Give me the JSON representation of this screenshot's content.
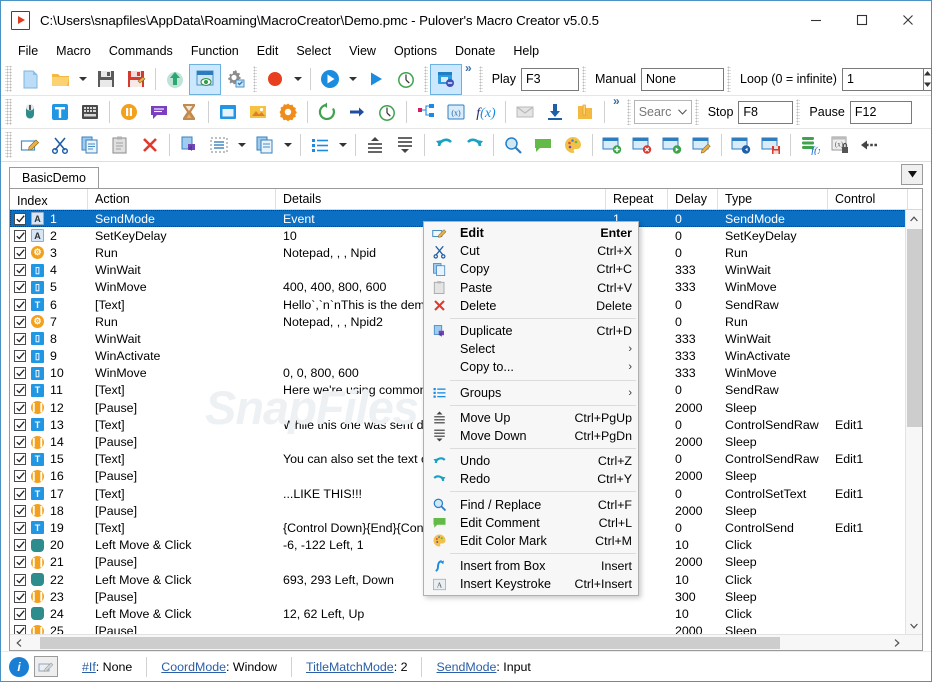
{
  "window": {
    "title": "C:\\Users\\snapfiles\\AppData\\Roaming\\MacroCreator\\Demo.pmc - Pulover's Macro Creator v5.0.5",
    "app_icon": "play-document-icon",
    "minimize": "Minimize",
    "maximize": "Maximize",
    "close": "Close"
  },
  "menubar": {
    "items": [
      {
        "label": "File"
      },
      {
        "label": "Macro"
      },
      {
        "label": "Commands"
      },
      {
        "label": "Function"
      },
      {
        "label": "Edit"
      },
      {
        "label": "Select"
      },
      {
        "label": "View"
      },
      {
        "label": "Options"
      },
      {
        "label": "Donate"
      },
      {
        "label": "Help"
      }
    ]
  },
  "toolbar": {
    "row1_fields": {
      "play_label": "Play",
      "play_value": "F3",
      "manual_label": "Manual",
      "manual_value": "None",
      "loop_label": "Loop (0 = infinite)",
      "loop_value": "1"
    },
    "row2_fields": {
      "search_value": "Searc",
      "stop_label": "Stop",
      "stop_value": "F8",
      "pause_label": "Pause",
      "pause_value": "F12"
    },
    "overflow_label": "»"
  },
  "tabs": {
    "items": [
      {
        "label": "BasicDemo"
      }
    ],
    "dropdown_label": "▼"
  },
  "list": {
    "columns": [
      {
        "key": "index",
        "label": "Index"
      },
      {
        "key": "action",
        "label": "Action"
      },
      {
        "key": "details",
        "label": "Details"
      },
      {
        "key": "repeat",
        "label": "Repeat"
      },
      {
        "key": "delay",
        "label": "Delay"
      },
      {
        "key": "type",
        "label": "Type"
      },
      {
        "key": "control",
        "label": "Control"
      }
    ],
    "watermark": "SnapFiles",
    "rows": [
      {
        "checked": true,
        "icon": "keyboard-icon",
        "index": "1",
        "action": "SendMode",
        "details": "Event",
        "repeat": "1",
        "delay": "0",
        "type": "SendMode",
        "control": "",
        "selected": true
      },
      {
        "checked": true,
        "icon": "keyboard-icon",
        "index": "2",
        "action": "SetKeyDelay",
        "details": "10",
        "repeat": "",
        "delay": "0",
        "type": "SetKeyDelay",
        "control": ""
      },
      {
        "checked": true,
        "icon": "run-icon",
        "index": "3",
        "action": "Run",
        "details": "Notepad, , , Npid",
        "repeat": "",
        "delay": "0",
        "type": "Run",
        "control": ""
      },
      {
        "checked": true,
        "icon": "window-icon",
        "index": "4",
        "action": "WinWait",
        "details": "",
        "repeat": "",
        "delay": "333",
        "type": "WinWait",
        "control": ""
      },
      {
        "checked": true,
        "icon": "window-icon",
        "index": "5",
        "action": "WinMove",
        "details": "400, 400, 800, 600",
        "repeat": "",
        "delay": "333",
        "type": "WinMove",
        "control": ""
      },
      {
        "checked": true,
        "icon": "text-icon",
        "index": "6",
        "action": "[Text]",
        "details": "Hello`,`n`nThis is the demonstrati",
        "repeat": "",
        "delay": "0",
        "type": "SendRaw",
        "control": ""
      },
      {
        "checked": true,
        "icon": "run-icon",
        "index": "7",
        "action": "Run",
        "details": "Notepad, , , Npid2",
        "repeat": "",
        "delay": "0",
        "type": "Run",
        "control": ""
      },
      {
        "checked": true,
        "icon": "window-icon",
        "index": "8",
        "action": "WinWait",
        "details": "",
        "repeat": "",
        "delay": "333",
        "type": "WinWait",
        "control": ""
      },
      {
        "checked": true,
        "icon": "window-icon",
        "index": "9",
        "action": "WinActivate",
        "details": "",
        "repeat": "",
        "delay": "333",
        "type": "WinActivate",
        "control": ""
      },
      {
        "checked": true,
        "icon": "window-icon",
        "index": "10",
        "action": "WinMove",
        "details": "0, 0, 800, 600",
        "repeat": "",
        "delay": "333",
        "type": "WinMove",
        "control": ""
      },
      {
        "checked": true,
        "icon": "text-icon",
        "index": "11",
        "action": "[Text]",
        "details": "Here we're using commonly used",
        "repeat": "",
        "delay": "0",
        "type": "SendRaw",
        "control": ""
      },
      {
        "checked": true,
        "icon": "pause-icon",
        "index": "12",
        "action": "[Pause]",
        "details": "",
        "repeat": "",
        "delay": "2000",
        "type": "Sleep",
        "control": ""
      },
      {
        "checked": true,
        "icon": "text-icon",
        "index": "13",
        "action": "[Text]",
        "details": "While this one was sent directly t",
        "repeat": "",
        "delay": "0",
        "type": "ControlSendRaw",
        "control": "Edit1"
      },
      {
        "checked": true,
        "icon": "pause-icon",
        "index": "14",
        "action": "[Pause]",
        "details": "",
        "repeat": "",
        "delay": "2000",
        "type": "Sleep",
        "control": ""
      },
      {
        "checked": true,
        "icon": "text-icon",
        "index": "15",
        "action": "[Text]",
        "details": "You can also set the text of the e",
        "repeat": "",
        "delay": "0",
        "type": "ControlSendRaw",
        "control": "Edit1"
      },
      {
        "checked": true,
        "icon": "pause-icon",
        "index": "16",
        "action": "[Pause]",
        "details": "",
        "repeat": "",
        "delay": "2000",
        "type": "Sleep",
        "control": ""
      },
      {
        "checked": true,
        "icon": "text-icon",
        "index": "17",
        "action": "[Text]",
        "details": "...LIKE THIS!!!",
        "repeat": "",
        "delay": "0",
        "type": "ControlSetText",
        "control": "Edit1"
      },
      {
        "checked": true,
        "icon": "pause-icon",
        "index": "18",
        "action": "[Pause]",
        "details": "",
        "repeat": "",
        "delay": "2000",
        "type": "Sleep",
        "control": ""
      },
      {
        "checked": true,
        "icon": "text-icon",
        "index": "19",
        "action": "[Text]",
        "details": "{Control Down}{End}{Control UP",
        "repeat": "",
        "delay": "0",
        "type": "ControlSend",
        "control": "Edit1"
      },
      {
        "checked": true,
        "icon": "mouse-icon",
        "index": "20",
        "action": "Left Move & Click",
        "details": "-6, -122 Left, 1",
        "repeat": "",
        "delay": "10",
        "type": "Click",
        "control": ""
      },
      {
        "checked": true,
        "icon": "pause-icon",
        "index": "21",
        "action": "[Pause]",
        "details": "",
        "repeat": "",
        "delay": "2000",
        "type": "Sleep",
        "control": ""
      },
      {
        "checked": true,
        "icon": "mouse-icon",
        "index": "22",
        "action": "Left Move & Click",
        "details": "693, 293 Left, Down",
        "repeat": "",
        "delay": "10",
        "type": "Click",
        "control": ""
      },
      {
        "checked": true,
        "icon": "pause-icon",
        "index": "23",
        "action": "[Pause]",
        "details": "",
        "repeat": "",
        "delay": "300",
        "type": "Sleep",
        "control": ""
      },
      {
        "checked": true,
        "icon": "mouse-icon",
        "index": "24",
        "action": "Left Move & Click",
        "details": "12, 62 Left, Up",
        "repeat": "",
        "delay": "10",
        "type": "Click",
        "control": ""
      },
      {
        "checked": true,
        "icon": "pause-icon",
        "index": "25",
        "action": "[Pause]",
        "details": "",
        "repeat": "",
        "delay": "2000",
        "type": "Sleep",
        "control": ""
      }
    ]
  },
  "context_menu": {
    "items": [
      {
        "icon": "edit-icon",
        "label": "Edit",
        "accel": "Enter",
        "bold": true
      },
      {
        "icon": "cut-icon",
        "label": "Cut",
        "accel": "Ctrl+X"
      },
      {
        "icon": "copy-icon",
        "label": "Copy",
        "accel": "Ctrl+C"
      },
      {
        "icon": "paste-icon",
        "label": "Paste",
        "accel": "Ctrl+V"
      },
      {
        "icon": "delete-icon",
        "label": "Delete",
        "accel": "Delete"
      },
      {
        "separator": true
      },
      {
        "icon": "duplicate-icon",
        "label": "Duplicate",
        "accel": "Ctrl+D"
      },
      {
        "icon": "",
        "label": "Select",
        "submenu": true
      },
      {
        "icon": "",
        "label": "Copy to...",
        "submenu": true
      },
      {
        "separator": true
      },
      {
        "icon": "groups-icon",
        "label": "Groups",
        "submenu": true
      },
      {
        "separator": true
      },
      {
        "icon": "move-up-icon",
        "label": "Move Up",
        "accel": "Ctrl+PgUp"
      },
      {
        "icon": "move-down-icon",
        "label": "Move Down",
        "accel": "Ctrl+PgDn"
      },
      {
        "separator": true
      },
      {
        "icon": "undo-icon",
        "label": "Undo",
        "accel": "Ctrl+Z"
      },
      {
        "icon": "redo-icon",
        "label": "Redo",
        "accel": "Ctrl+Y"
      },
      {
        "separator": true
      },
      {
        "icon": "find-replace-icon",
        "label": "Find / Replace",
        "accel": "Ctrl+F"
      },
      {
        "icon": "comment-icon",
        "label": "Edit Comment",
        "accel": "Ctrl+L"
      },
      {
        "icon": "color-mark-icon",
        "label": "Edit Color Mark",
        "accel": "Ctrl+M"
      },
      {
        "separator": true
      },
      {
        "icon": "insert-box-icon",
        "label": "Insert from Box",
        "accel": "Insert"
      },
      {
        "icon": "keystroke-icon",
        "label": "Insert Keystroke",
        "accel": "Ctrl+Insert"
      }
    ]
  },
  "statusbar": {
    "info_icon": "info-icon",
    "edit_icon": "edit-pencil-icon",
    "segments": [
      {
        "link": "#If",
        "value": ": None"
      },
      {
        "link": "CoordMode",
        "value": ": Window"
      },
      {
        "link": "TitleMatchMode",
        "value": ": 2"
      },
      {
        "link": "SendMode",
        "value": ": Input"
      }
    ]
  },
  "colors": {
    "accent": "#0b6fc4",
    "window_border": "#4a93c4",
    "selection": "#0b6fc4",
    "link": "#2b5fa8"
  }
}
